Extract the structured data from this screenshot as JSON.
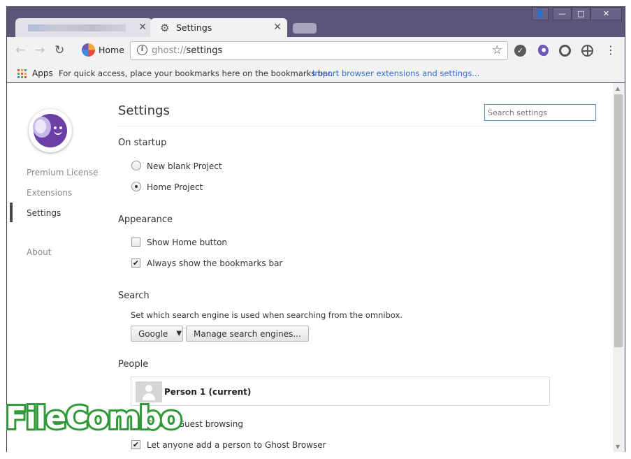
{
  "window_controls": {
    "user": "👤",
    "minimize": "—",
    "maximize": "□",
    "close": "✕"
  },
  "tabs": [
    {
      "label": "",
      "close": "✕"
    },
    {
      "label": "Settings",
      "close": "✕"
    }
  ],
  "toolbar": {
    "home_label": "Home",
    "url_scheme": "ghost://",
    "url_path": "settings"
  },
  "bookmarks": {
    "apps_label": "Apps",
    "hint": "For quick access, place your bookmarks here on the bookmarks bar.",
    "import_link": "Import browser extensions and settings..."
  },
  "sidebar": {
    "items": [
      {
        "label": "Premium License"
      },
      {
        "label": "Extensions"
      },
      {
        "label": "Settings"
      },
      {
        "label": "About"
      }
    ]
  },
  "settings": {
    "title": "Settings",
    "search_placeholder": "Search settings",
    "startup": {
      "heading": "On startup",
      "options": [
        {
          "label": "New blank Project",
          "selected": false
        },
        {
          "label": "Home Project",
          "selected": true
        }
      ]
    },
    "appearance": {
      "heading": "Appearance",
      "options": [
        {
          "label": "Show Home button",
          "checked": false
        },
        {
          "label": "Always show the bookmarks bar",
          "checked": true
        }
      ]
    },
    "search": {
      "heading": "Search",
      "description": "Set which search engine is used when searching from the omnibox.",
      "engine": "Google",
      "manage_label": "Manage search engines..."
    },
    "people": {
      "heading": "People",
      "person_name": "Person 1 (current)",
      "guest_label": "Enable Guest browsing",
      "add_person_label": "Let anyone add a person to Ghost Browser"
    }
  },
  "watermark": "FileCombo",
  "colors": {
    "accent": "#5d5577",
    "link": "#2f6ed8",
    "watermark": "#2f9a37"
  }
}
